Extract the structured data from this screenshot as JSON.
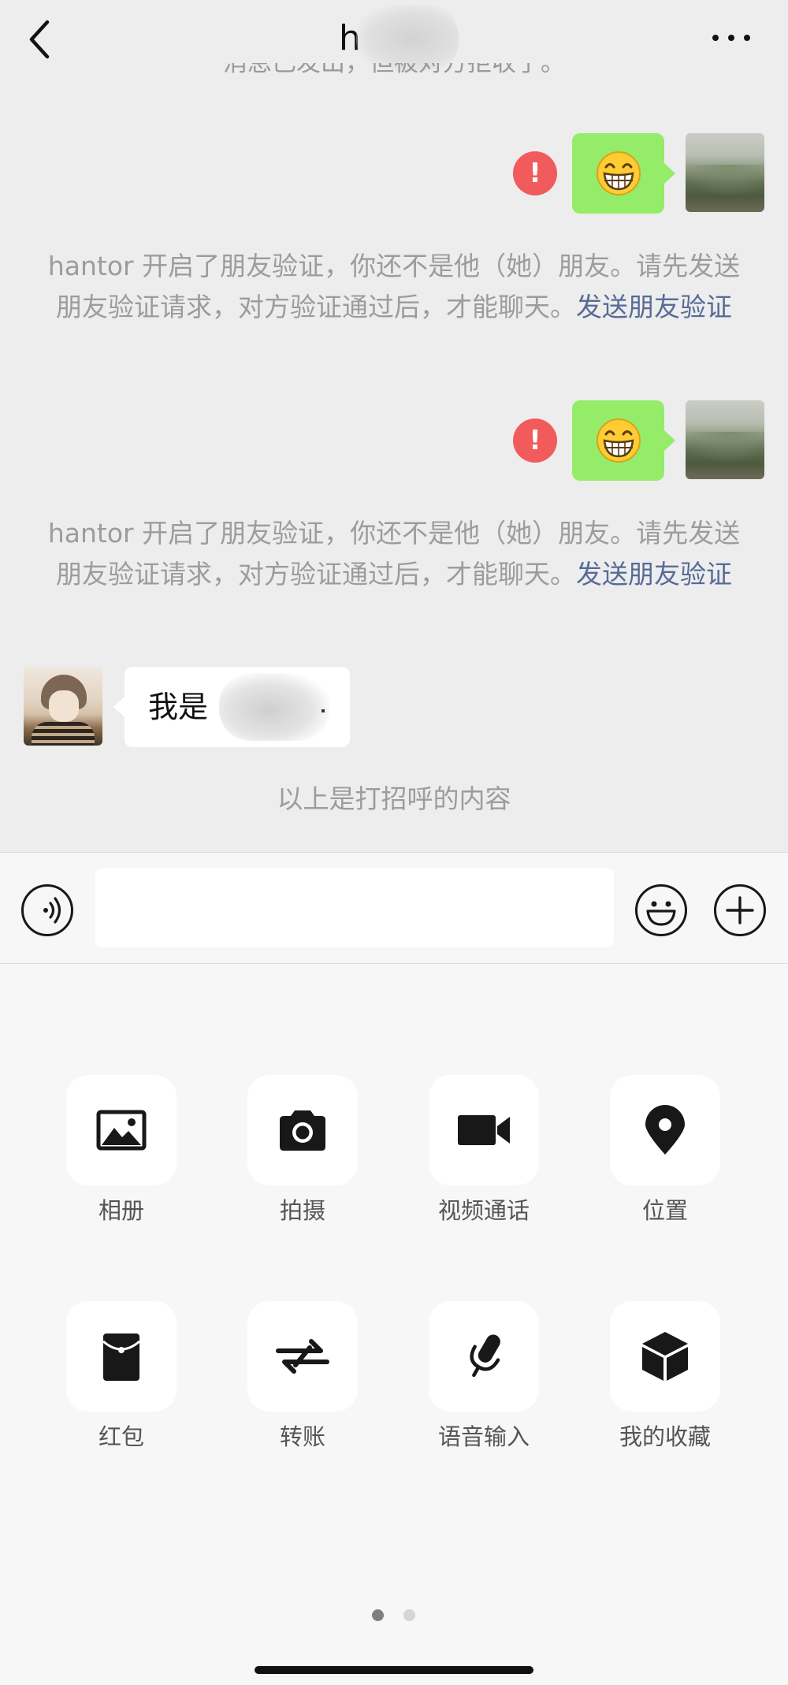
{
  "header": {
    "title_visible": "h",
    "back_icon": "chevron-left-icon",
    "more_icon": "ellipsis-icon"
  },
  "chat": {
    "cut_notice": "消息已发出，但被对方拒收了。",
    "outgoing": [
      {
        "emoji": "grinning-face",
        "status": "failed"
      },
      {
        "emoji": "grinning-face",
        "status": "failed"
      }
    ],
    "system_notices": [
      {
        "text": "hantor 开启了朋友验证，你还不是他（她）朋友。请先发送朋友验证请求，对方验证通过后，才能聊天。",
        "link": "发送朋友验证"
      },
      {
        "text": "hantor 开启了朋友验证，你还不是他（她）朋友。请先发送朋友验证请求，对方验证通过后，才能聊天。",
        "link": "发送朋友验证"
      }
    ],
    "incoming": {
      "text": "我是",
      "trailing": "."
    },
    "greeting_note": "以上是打招呼的内容"
  },
  "input_bar": {
    "voice_icon": "voice-icon",
    "emoji_icon": "emoji-icon",
    "plus_icon": "plus-icon",
    "value": ""
  },
  "panel": {
    "tools": [
      {
        "label": "相册",
        "icon": "photo-album-icon"
      },
      {
        "label": "拍摄",
        "icon": "camera-icon"
      },
      {
        "label": "视频通话",
        "icon": "video-call-icon"
      },
      {
        "label": "位置",
        "icon": "location-icon"
      },
      {
        "label": "红包",
        "icon": "red-packet-icon"
      },
      {
        "label": "转账",
        "icon": "transfer-icon"
      },
      {
        "label": "语音输入",
        "icon": "microphone-icon"
      },
      {
        "label": "我的收藏",
        "icon": "favorites-icon"
      }
    ],
    "pager": {
      "pages": 2,
      "active": 1
    }
  },
  "colors": {
    "chat_bg": "#ededed",
    "bubble_out": "#95ec69",
    "bubble_in": "#ffffff",
    "failure": "#f25b5b",
    "link": "#576b95",
    "panel_bg": "#f7f7f7"
  }
}
